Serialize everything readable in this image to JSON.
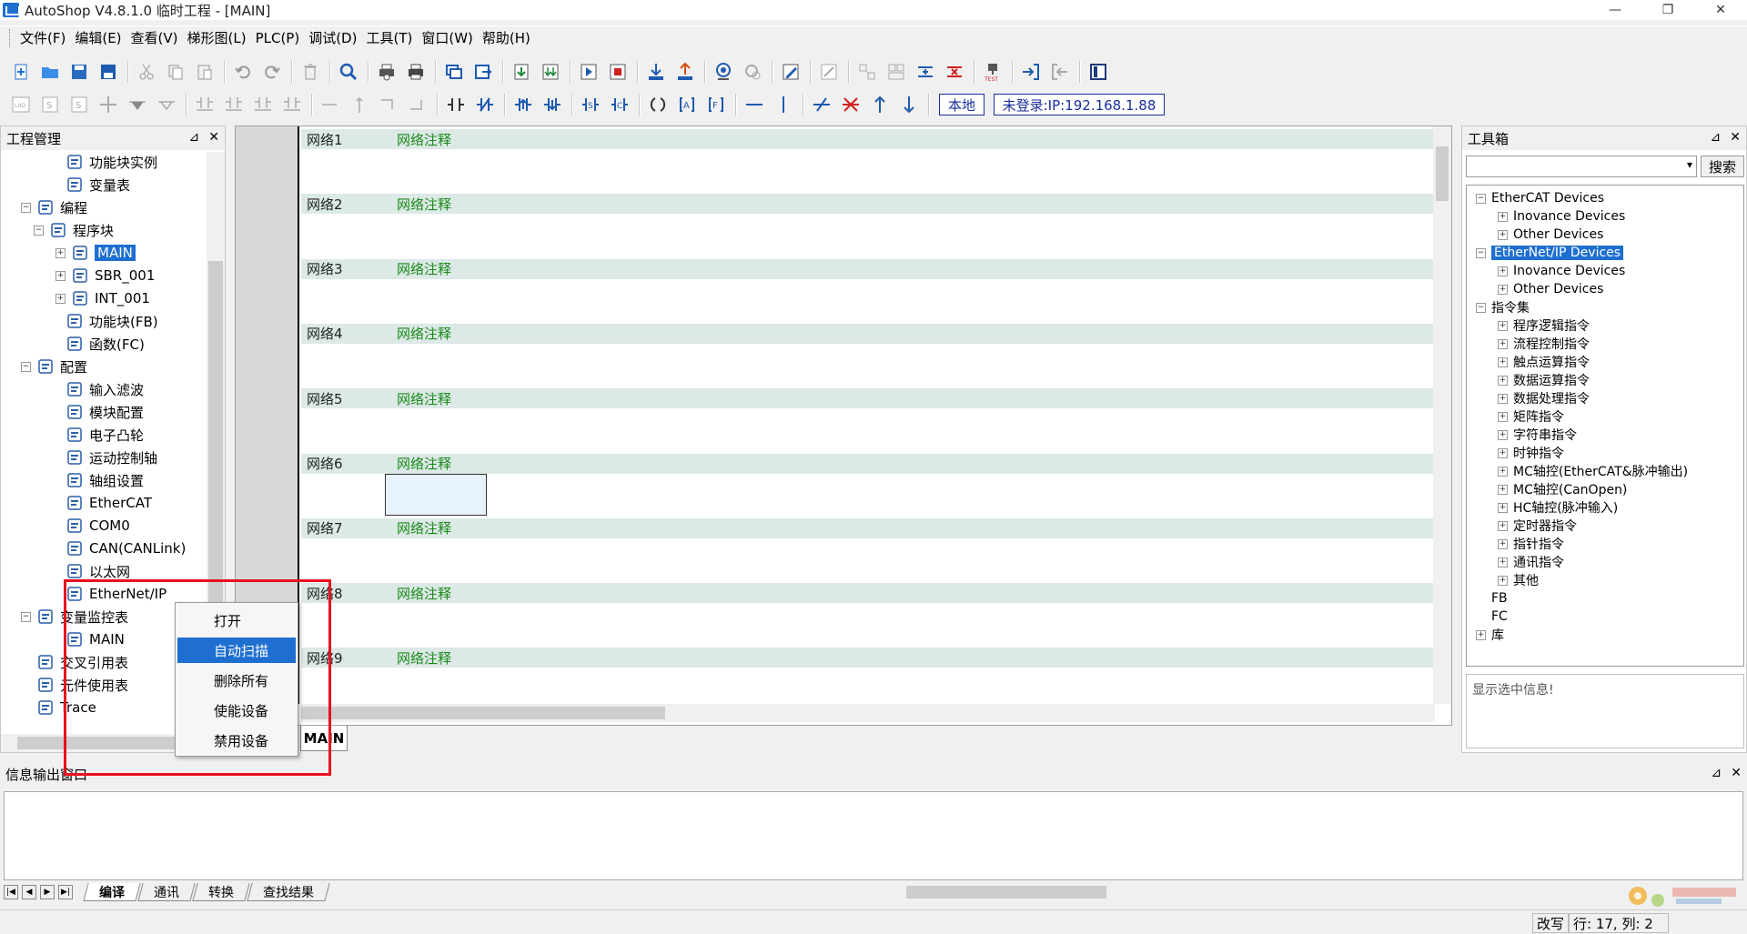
{
  "window": {
    "title": "AutoShop V4.8.1.0  临时工程 - [MAIN]",
    "minimize": "—",
    "restore": "❐",
    "close": "✕"
  },
  "menu": [
    "文件(F)",
    "编辑(E)",
    "查看(V)",
    "梯形图(L)",
    "PLC(P)",
    "调试(D)",
    "工具(T)",
    "窗口(W)",
    "帮助(H)"
  ],
  "toolbar2": {
    "local_label": "本地",
    "login_label": "未登录:IP:192.168.1.88"
  },
  "project_panel": {
    "title": "工程管理",
    "pin": "⊿",
    "close": "✕",
    "nodes": [
      {
        "label": "功能块实例",
        "icon": "cube-icon"
      },
      {
        "label": "变量表",
        "icon": "globe-icon"
      },
      {
        "label": "编程",
        "icon": "program-icon",
        "exp": "−"
      },
      {
        "label": "程序块",
        "icon": "grid-icon",
        "exp": "−"
      },
      {
        "label": "MAIN",
        "icon": "main-doc-icon",
        "exp": "+"
      },
      {
        "label": "SBR_001",
        "icon": "sbr-doc-icon",
        "exp": "+"
      },
      {
        "label": "INT_001",
        "icon": "int-doc-icon",
        "exp": "+"
      },
      {
        "label": "功能块(FB)",
        "icon": "fb-icon"
      },
      {
        "label": "函数(FC)",
        "icon": "fc-icon"
      },
      {
        "label": "配置",
        "icon": "config-icon",
        "exp": "−"
      },
      {
        "label": "输入滤波",
        "icon": "filter-icon"
      },
      {
        "label": "模块配置",
        "icon": "module-icon"
      },
      {
        "label": "电子凸轮",
        "icon": "cam-icon"
      },
      {
        "label": "运动控制轴",
        "icon": "axis-icon"
      },
      {
        "label": "轴组设置",
        "icon": "gear-icon"
      },
      {
        "label": "EtherCAT",
        "icon": "ethercat-icon"
      },
      {
        "label": "COM0",
        "icon": "com-icon"
      },
      {
        "label": "CAN(CANLink)",
        "icon": "can-icon"
      },
      {
        "label": "以太网",
        "icon": "ethernet-icon"
      },
      {
        "label": "EtherNet/IP",
        "icon": "ethernetip-icon"
      },
      {
        "label": "变量监控表",
        "icon": "monitor-icon",
        "exp": "−"
      },
      {
        "label": "MAIN",
        "icon": "table-icon"
      },
      {
        "label": "交叉引用表",
        "icon": "crossref-icon"
      },
      {
        "label": "元件使用表",
        "icon": "database-icon"
      },
      {
        "label": "Trace",
        "icon": "trace-icon"
      }
    ]
  },
  "context_menu": {
    "items": [
      "打开",
      "自动扫描",
      "删除所有",
      "使能设备",
      "禁用设备"
    ],
    "highlighted": 1
  },
  "editor": {
    "networks": [
      {
        "label": "网络1",
        "comment": "网络注释"
      },
      {
        "label": "网络2",
        "comment": "网络注释"
      },
      {
        "label": "网络3",
        "comment": "网络注释"
      },
      {
        "label": "网络4",
        "comment": "网络注释"
      },
      {
        "label": "网络5",
        "comment": "网络注释"
      },
      {
        "label": "网络6",
        "comment": "网络注释"
      },
      {
        "label": "网络7",
        "comment": "网络注释"
      },
      {
        "label": "网络8",
        "comment": "网络注释"
      },
      {
        "label": "网络9",
        "comment": "网络注释"
      }
    ],
    "tab": "MAIN",
    "comment_color": "#1a8a1a",
    "header_bg": "#dce9e6"
  },
  "toolbox": {
    "title": "工具箱",
    "search_button": "搜索",
    "info_text": "显示选中信息!",
    "nodes": [
      {
        "label": "EtherCAT Devices",
        "level": 0,
        "exp": "−"
      },
      {
        "label": "Inovance Devices",
        "level": 1,
        "exp": "+"
      },
      {
        "label": "Other Devices",
        "level": 1,
        "exp": "+"
      },
      {
        "label": "EtherNet/IP Devices",
        "level": 0,
        "exp": "−",
        "selected": true
      },
      {
        "label": "Inovance Devices",
        "level": 1,
        "exp": "+"
      },
      {
        "label": "Other Devices",
        "level": 1,
        "exp": "+"
      },
      {
        "label": "指令集",
        "level": 0,
        "exp": "−"
      },
      {
        "label": "程序逻辑指令",
        "level": 1,
        "exp": "+"
      },
      {
        "label": "流程控制指令",
        "level": 1,
        "exp": "+"
      },
      {
        "label": "触点运算指令",
        "level": 1,
        "exp": "+"
      },
      {
        "label": "数据运算指令",
        "level": 1,
        "exp": "+"
      },
      {
        "label": "数据处理指令",
        "level": 1,
        "exp": "+"
      },
      {
        "label": "矩阵指令",
        "level": 1,
        "exp": "+"
      },
      {
        "label": "字符串指令",
        "level": 1,
        "exp": "+"
      },
      {
        "label": "时钟指令",
        "level": 1,
        "exp": "+"
      },
      {
        "label": "MC轴控(EtherCAT&脉冲输出)",
        "level": 1,
        "exp": "+"
      },
      {
        "label": "MC轴控(CanOpen)",
        "level": 1,
        "exp": "+"
      },
      {
        "label": "HC轴控(脉冲输入)",
        "level": 1,
        "exp": "+"
      },
      {
        "label": "定时器指令",
        "level": 1,
        "exp": "+"
      },
      {
        "label": "指针指令",
        "level": 1,
        "exp": "+"
      },
      {
        "label": "通讯指令",
        "level": 1,
        "exp": "+"
      },
      {
        "label": "其他",
        "level": 1,
        "exp": "+"
      },
      {
        "label": "FB",
        "level": 0,
        "exp": ""
      },
      {
        "label": "FC",
        "level": 0,
        "exp": ""
      },
      {
        "label": "库",
        "level": 0,
        "exp": "+"
      }
    ]
  },
  "output": {
    "title": "信息输出窗口",
    "tabs": [
      "编译",
      "通讯",
      "转换",
      "查找结果"
    ],
    "active_tab": 0
  },
  "status": {
    "mode": "改写",
    "position": "行:   17, 列:   2"
  },
  "colors": {
    "accent": "#1e6fd0",
    "annotation_red": "#e8121e",
    "pill_blue": "#1a2f9c"
  }
}
